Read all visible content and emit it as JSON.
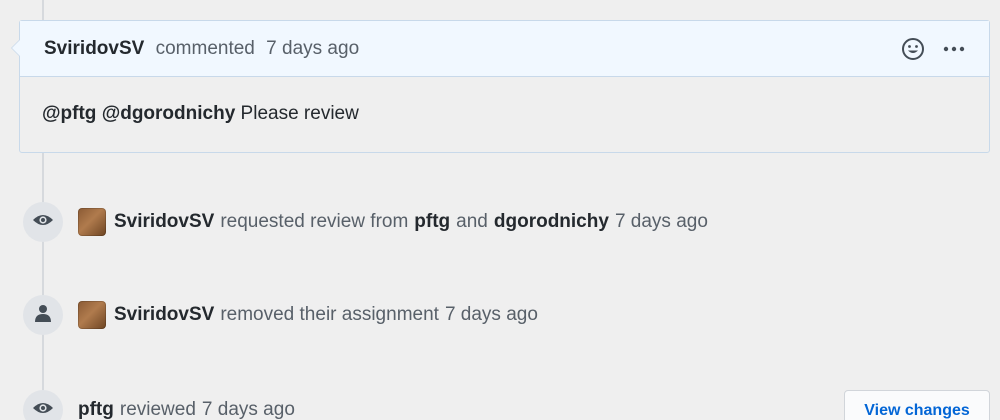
{
  "comment": {
    "author": "SviridovSV",
    "action": "commented",
    "time": "7 days ago",
    "mention_1": "@pftg",
    "mention_2": "@dgorodnichy",
    "body_text": "Please review"
  },
  "events": [
    {
      "icon": "eye-icon",
      "actor": "SviridovSV",
      "text_1": "requested review from",
      "user_1": "pftg",
      "text_2": "and",
      "user_2": "dgorodnichy",
      "time": "7 days ago"
    },
    {
      "icon": "person-icon",
      "actor": "SviridovSV",
      "text_1": "removed their assignment",
      "time": "7 days ago"
    },
    {
      "icon": "eye-icon",
      "actor": "pftg",
      "text_1": "reviewed",
      "time": "7 days ago",
      "button": "View changes"
    }
  ],
  "colors": {
    "link": "#0366d6",
    "header_bg": "#f1f8ff",
    "border": "#c8d9ea"
  }
}
